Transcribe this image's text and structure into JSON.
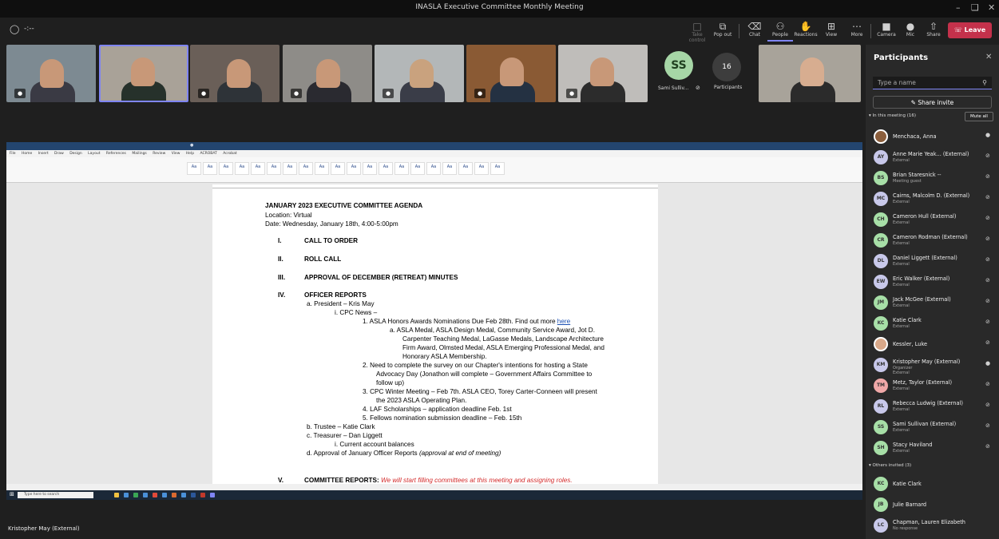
{
  "window": {
    "title": "INASLA Executive Committee Monthly Meeting"
  },
  "toolbar": {
    "items": [
      {
        "label": "Take control",
        "icon": "take-control-icon",
        "dim": true
      },
      {
        "label": "Pop out",
        "icon": "pop-out-icon"
      },
      {
        "label": "Chat",
        "icon": "chat-icon"
      },
      {
        "label": "People",
        "icon": "people-icon",
        "active": true
      },
      {
        "label": "Reactions",
        "icon": "reactions-icon"
      },
      {
        "label": "View",
        "icon": "view-icon"
      },
      {
        "label": "More",
        "icon": "more-icon"
      },
      {
        "label": "Camera",
        "icon": "camera-icon"
      },
      {
        "label": "Mic",
        "icon": "mic-icon"
      },
      {
        "label": "Share",
        "icon": "share-icon"
      }
    ],
    "leave_label": "Leave",
    "accent": "#7f85f5",
    "leave_color": "#c4314b"
  },
  "video": {
    "sami_initials": "SS",
    "sami_name": "Sami Sulliv...",
    "participant_count": "16",
    "participants_label": "Participants"
  },
  "word": {
    "tabs": "File Home Insert Draw Design Layout References Mailings Review View Help ACROBAT Acrobat"
  },
  "doc": {
    "heading": "JANUARY 2023 EXECUTIVE COMMITTEE AGENDA",
    "location": "Location: Virtual",
    "date": "Date:  Wednesday, January 18th, 4:00-5:00pm",
    "s1_num": "I.",
    "s1": "CALL TO ORDER",
    "s2_num": "II.",
    "s2": "ROLL CALL",
    "s3_num": "III.",
    "s3": "APPROVAL OF DECEMBER (RETREAT) MINUTES",
    "s4_num": "IV.",
    "s4": "OFFICER REPORTS",
    "a": "a.   President – Kris May",
    "ai": "i.    CPC News –",
    "n1": "1.    ASLA Honors Awards Nominations Due Feb 28th. Find out more",
    "n1_link": "here",
    "n1a_1": "a.    ASLA Medal, ASLA Design Medal, Community Service Award, Jot D.",
    "n1a_2": "Carpenter Teaching Medal, LaGasse Medals, Landscape Architecture",
    "n1a_3": "Firm Award, Olmsted Medal, ASLA Emerging Professional Medal, and",
    "n1a_4": "Honorary ASLA Membership.",
    "n2_1": "2.    Need to complete the survey on our Chapter's intentions for hosting a State",
    "n2_2": "Advocacy Day (Jonathon will complete – Government Affairs Committee to",
    "n2_3": "follow up)",
    "n3_1": "3.    CPC Winter Meeting – Feb 7th. ASLA CEO, Torey Carter-Conneen will present",
    "n3_2": "the 2023 ASLA Operating Plan.",
    "n4": "4.    LAF Scholarships – application deadline Feb. 1st",
    "n5": "5.    Fellows nomination submission deadline – Feb. 15th",
    "b": "b.   Trustee – Katie Clark",
    "c": "c.   Treasurer – Dan Liggett",
    "ci": "i.    Current account balances",
    "d": "d.   Approval of January Officer Reports",
    "d_italic": "(approval at end of meeting)",
    "s5_num": "V.",
    "s5": "COMMITTEE REPORTS:",
    "s5_red": "We will start filling committees at this meeting and assigning roles."
  },
  "taskbar": {
    "search_placeholder": "Type here to search"
  },
  "presenter_name": "Kristopher May (External)",
  "panel": {
    "title": "Participants",
    "search_placeholder": "Type a name",
    "share_invite": "Share invite",
    "in_meeting": "In this meeting (16)",
    "mute_all": "Mute all",
    "others_invited": "Others invited (3)",
    "in_meeting_list": [
      {
        "name": "Menchaca, Anna",
        "role": "",
        "initials": "",
        "color": "#8b5e3c",
        "photo": true,
        "mic": "on"
      },
      {
        "name": "Anne Marie Yeak... (External)",
        "role": "External",
        "initials": "AY",
        "color": "#c8c8ea",
        "mic": "off"
      },
      {
        "name": "Brian Staresnick --",
        "role": "Meeting guest",
        "initials": "BS",
        "color": "#a7dfa7",
        "mic": "off"
      },
      {
        "name": "Cairns, Malcolm D. (External)",
        "role": "External",
        "initials": "MC",
        "color": "#c8c8ea",
        "mic": "off"
      },
      {
        "name": "Cameron Hull (External)",
        "role": "External",
        "initials": "CH",
        "color": "#a7dfa7",
        "mic": "off"
      },
      {
        "name": "Cameron Rodman (External)",
        "role": "External",
        "initials": "CR",
        "color": "#a7dfa7",
        "mic": "off"
      },
      {
        "name": "Daniel Liggett (External)",
        "role": "External",
        "initials": "DL",
        "color": "#c8c8ea",
        "mic": "off"
      },
      {
        "name": "Eric Walker (External)",
        "role": "External",
        "initials": "EW",
        "color": "#c8c8ea",
        "mic": "off"
      },
      {
        "name": "Jack McGee (External)",
        "role": "External",
        "initials": "JM",
        "color": "#a7dfa7",
        "mic": "off"
      },
      {
        "name": "Katie Clark",
        "role": "External",
        "initials": "KC",
        "color": "#a7dfa7",
        "mic": "off"
      },
      {
        "name": "Kessler, Luke",
        "role": "",
        "initials": "",
        "color": "#d9a889",
        "photo": true,
        "mic": "off"
      },
      {
        "name": "Kristopher May (External)",
        "role": "Organizer",
        "role2": "External",
        "initials": "KM",
        "color": "#c8c8ea",
        "mic": "on",
        "bold": true
      },
      {
        "name": "Metz, Taylor (External)",
        "role": "External",
        "initials": "TM",
        "color": "#f0a8a8",
        "mic": "off"
      },
      {
        "name": "Rebecca Ludwig (External)",
        "role": "External",
        "initials": "RL",
        "color": "#c8c8ea",
        "mic": "off"
      },
      {
        "name": "Sami Sullivan (External)",
        "role": "External",
        "initials": "SS",
        "color": "#a7dfa7",
        "mic": "off"
      },
      {
        "name": "Stacy Haviland",
        "role": "External",
        "initials": "SH",
        "color": "#a7dfa7",
        "mic": "off"
      }
    ],
    "invited_list": [
      {
        "name": "Katie Clark",
        "role": "",
        "initials": "KC",
        "color": "#a7dfa7"
      },
      {
        "name": "Julie Barnard",
        "role": "",
        "initials": "JB",
        "color": "#a7dfa7"
      },
      {
        "name": "Chapman, Lauren Elizabeth",
        "role": "No response",
        "initials": "LC",
        "color": "#c8c8ea"
      }
    ]
  }
}
